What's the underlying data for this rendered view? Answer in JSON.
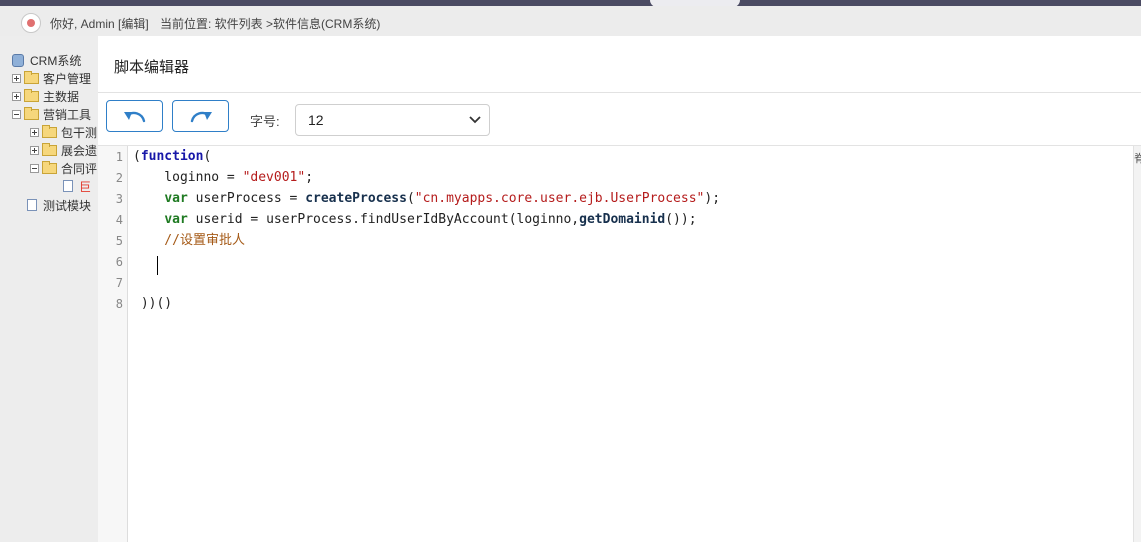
{
  "header": {
    "greeting": "你好, Admin [编辑]",
    "location": "当前位置: 软件列表 >软件信息(CRM系统)"
  },
  "tree": {
    "root": "CRM系统",
    "items": [
      {
        "label": "客户管理",
        "toggle": "+"
      },
      {
        "label": "主数据",
        "toggle": "+"
      },
      {
        "label": "营销工具",
        "toggle": "-"
      },
      {
        "label": "包干测",
        "toggle": "+"
      },
      {
        "label": "展会遗",
        "toggle": "+"
      },
      {
        "label": "合同评",
        "toggle": "-"
      },
      {
        "label": "巨",
        "toggle": ""
      },
      {
        "label": "测试模块",
        "toggle": ""
      }
    ]
  },
  "editor_panel": {
    "title": "脚本编辑器",
    "font_size_label": "字号:",
    "font_size_value": "12",
    "undo_icon": "undo-icon",
    "redo_icon": "redo-icon",
    "accent_color": "#2f7fc8",
    "right_edge_char": "脊"
  },
  "code": {
    "line_numbers": [
      "1",
      "2",
      "3",
      "4",
      "5",
      "6",
      "7",
      "8"
    ],
    "lines": [
      [
        {
          "t": "(",
          "c": ""
        },
        {
          "t": "function",
          "c": "kw"
        },
        {
          "t": "(",
          "c": ""
        }
      ],
      [
        {
          "t": "    loginno = ",
          "c": ""
        },
        {
          "t": "\"dev001\"",
          "c": "str"
        },
        {
          "t": ";",
          "c": ""
        }
      ],
      [
        {
          "t": "    ",
          "c": ""
        },
        {
          "t": "var",
          "c": "kw2"
        },
        {
          "t": " userProcess = ",
          "c": ""
        },
        {
          "t": "createProcess",
          "c": "fnc"
        },
        {
          "t": "(",
          "c": ""
        },
        {
          "t": "\"cn.myapps.core.user.ejb.UserProcess\"",
          "c": "str"
        },
        {
          "t": ");",
          "c": ""
        }
      ],
      [
        {
          "t": "    ",
          "c": ""
        },
        {
          "t": "var",
          "c": "kw2"
        },
        {
          "t": " userid = userProcess.findUserIdByAccount(loginno,",
          "c": ""
        },
        {
          "t": "getDomainid",
          "c": "fnc"
        },
        {
          "t": "());",
          "c": ""
        }
      ],
      [
        {
          "t": "    //设置审批人",
          "c": "cmt"
        }
      ],
      [
        {
          "t": "",
          "c": ""
        }
      ],
      [
        {
          "t": "",
          "c": ""
        }
      ],
      [
        {
          "t": " ))()",
          "c": ""
        }
      ]
    ]
  }
}
